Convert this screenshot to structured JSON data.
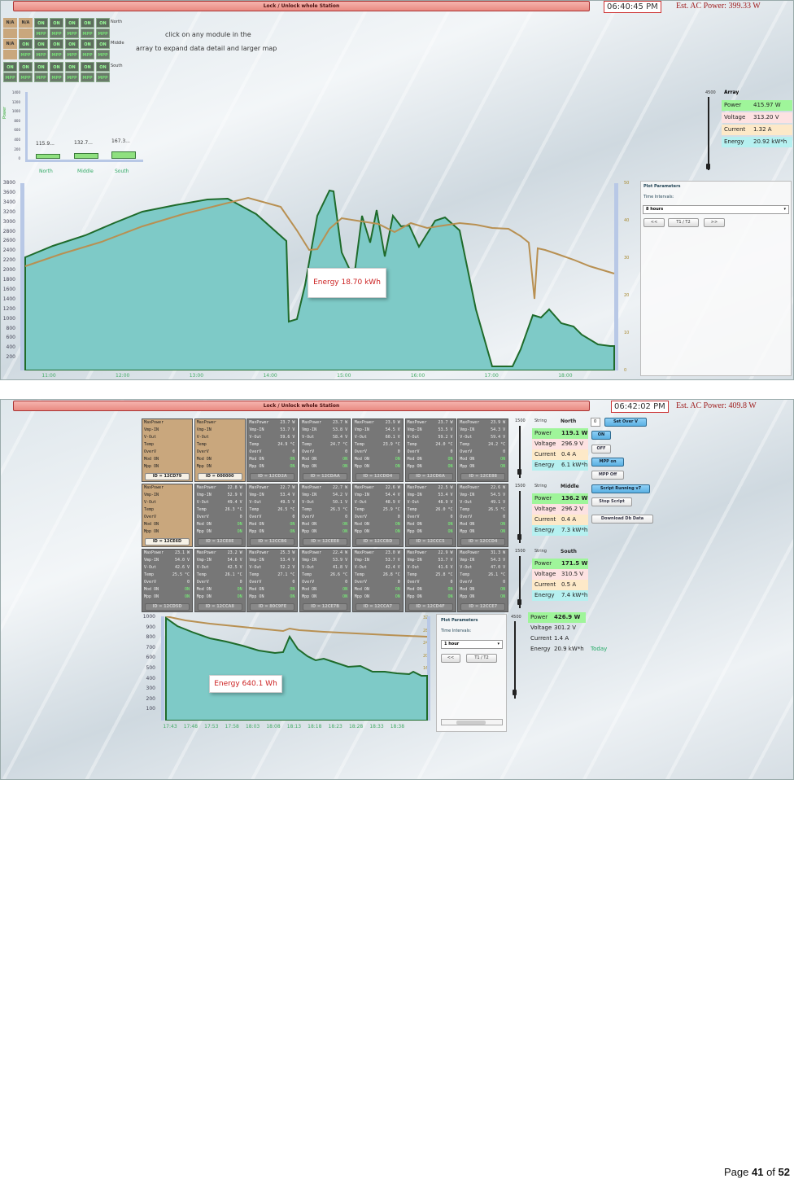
{
  "s1": {
    "lock_label": "Lock / Unlock whole Station",
    "clock": "06:40:45 PM",
    "ac_power": "Est. AC Power: 399.33 W",
    "hint1": "click on any module in the",
    "hint2": "array to expand data detail and larger map",
    "rows": [
      {
        "label": "North",
        "top": [
          "N/A",
          "N/A",
          "ON",
          "ON",
          "ON",
          "ON",
          "ON"
        ],
        "bottom": [
          "",
          "",
          "MPP",
          "MPP",
          "MPP",
          "MPP",
          "MPP"
        ]
      },
      {
        "label": "Middle",
        "top": [
          "N/A",
          "ON",
          "ON",
          "ON",
          "ON",
          "ON",
          "ON"
        ],
        "bottom": [
          "",
          "MPP",
          "MPP",
          "MPP",
          "MPP",
          "MPP",
          "MPP"
        ]
      },
      {
        "label": "South",
        "top": [
          "ON",
          "ON",
          "ON",
          "ON",
          "ON",
          "ON",
          "ON"
        ],
        "bottom": [
          "MPP",
          "MPP",
          "MPP",
          "MPP",
          "MPP",
          "MPP",
          "MPP"
        ]
      }
    ],
    "bar_labels": [
      "115.9...",
      "132.7...",
      "167.3..."
    ],
    "bar_cats": [
      "North",
      "Middle",
      "South"
    ],
    "bar_ylabel": "Power",
    "bar_yticks": [
      "1400",
      "1200",
      "1000",
      "800",
      "600",
      "400",
      "200",
      "0"
    ],
    "slider_max": "4500",
    "array_title": "Array",
    "readouts": [
      {
        "label": "Power",
        "value": "415.97 W"
      },
      {
        "label": "Voltage",
        "value": "313.20 V"
      },
      {
        "label": "Current",
        "value": "1.32 A"
      },
      {
        "label": "Energy",
        "value": "20.92 kW*h"
      }
    ],
    "energy_label": "Energy 18.70 kWh",
    "plot_params": "Plot Parameters",
    "time_intervals": "Time Intervals:",
    "interval": "8 hours",
    "btn_prev": "<<",
    "btn_t1t2": "T1 / T2",
    "btn_next": ">>",
    "yticks_left": [
      "3800",
      "3600",
      "3400",
      "3200",
      "3000",
      "2800",
      "2600",
      "2400",
      "2200",
      "2000",
      "1800",
      "1600",
      "1400",
      "1200",
      "1000",
      "800",
      "600",
      "400",
      "200"
    ],
    "yticks_right": [
      "50",
      "40",
      "30",
      "20",
      "10",
      "0"
    ],
    "xticks": [
      "11:00",
      "12:00",
      "13:00",
      "14:00",
      "15:00",
      "16:00",
      "17:00",
      "18:00"
    ]
  },
  "s2": {
    "lock_label": "Lock / Unlock whole Station",
    "clock": "06:42:02 PM",
    "ac_power": "Est. AC Power: 409.8 W",
    "modules": [
      [
        {
          "t": "tan",
          "max": "",
          "vmp": "",
          "vout": "",
          "temp": "",
          "overv": "",
          "mod": "",
          "mpp": "",
          "id": "ID = 12CD79"
        },
        {
          "t": "tan",
          "max": "",
          "vmp": "",
          "vout": "",
          "temp": "",
          "overv": "",
          "mod": "",
          "mpp": "",
          "id": "ID = 000000"
        },
        {
          "t": "gray",
          "max": "23.7 W",
          "vmp": "53.7 V",
          "vout": "59.6 V",
          "temp": "24.9 °C",
          "overv": "0",
          "mod": "ON",
          "mpp": "ON",
          "id": "ID = 12CD2A"
        },
        {
          "t": "gray",
          "max": "23.7 W",
          "vmp": "53.8 V",
          "vout": "58.4 V",
          "temp": "24.7 °C",
          "overv": "0",
          "mod": "ON",
          "mpp": "ON",
          "id": "ID = 12CDAA"
        },
        {
          "t": "gray",
          "max": "23.9 W",
          "vmp": "54.5 V",
          "vout": "60.1 V",
          "temp": "23.9 °C",
          "overv": "0",
          "mod": "ON",
          "mpp": "ON",
          "id": "ID = 12CDD4"
        },
        {
          "t": "gray",
          "max": "23.7 W",
          "vmp": "53.5 V",
          "vout": "59.2 V",
          "temp": "24.0 °C",
          "overv": "0",
          "mod": "ON",
          "mpp": "ON",
          "id": "ID = 12CD6A"
        },
        {
          "t": "gray",
          "max": "23.9 W",
          "vmp": "54.3 V",
          "vout": "59.4 V",
          "temp": "24.2 °C",
          "overv": "0",
          "mod": "ON",
          "mpp": "ON",
          "id": "ID = 12CE88"
        }
      ],
      [
        {
          "t": "tan",
          "max": "",
          "vmp": "",
          "vout": "",
          "temp": "",
          "overv": "",
          "mod": "",
          "mpp": "",
          "id": "ID = 12CE6D"
        },
        {
          "t": "gray",
          "max": "22.8 W",
          "vmp": "52.9 V",
          "vout": "49.4 V",
          "temp": "26.3 °C",
          "overv": "0",
          "mod": "ON",
          "mpp": "ON",
          "id": "ID = 12CE8E"
        },
        {
          "t": "gray",
          "max": "22.7 W",
          "vmp": "53.4 V",
          "vout": "49.5 V",
          "temp": "26.5 °C",
          "overv": "0",
          "mod": "ON",
          "mpp": "ON",
          "id": "ID = 12CCB6"
        },
        {
          "t": "gray",
          "max": "22.7 W",
          "vmp": "54.2 V",
          "vout": "50.1 V",
          "temp": "26.3 °C",
          "overv": "0",
          "mod": "ON",
          "mpp": "ON",
          "id": "ID = 12CEE8"
        },
        {
          "t": "gray",
          "max": "22.6 W",
          "vmp": "54.4 V",
          "vout": "48.9 V",
          "temp": "25.9 °C",
          "overv": "0",
          "mod": "ON",
          "mpp": "ON",
          "id": "ID = 12CCBD"
        },
        {
          "t": "gray",
          "max": "22.5 W",
          "vmp": "53.4 V",
          "vout": "48.9 V",
          "temp": "26.0 °C",
          "overv": "0",
          "mod": "ON",
          "mpp": "ON",
          "id": "ID = 12CCC5"
        },
        {
          "t": "gray",
          "max": "22.6 W",
          "vmp": "54.5 V",
          "vout": "49.1 V",
          "temp": "26.5 °C",
          "overv": "0",
          "mod": "ON",
          "mpp": "ON",
          "id": "ID = 12CCD4"
        }
      ],
      [
        {
          "t": "gray",
          "max": "23.1 W",
          "vmp": "54.0 V",
          "vout": "42.6 V",
          "temp": "25.5 °C",
          "overv": "0",
          "mod": "ON",
          "mpp": "ON",
          "id": "ID = 12CD5D"
        },
        {
          "t": "gray",
          "max": "23.2 W",
          "vmp": "54.6 V",
          "vout": "42.5 V",
          "temp": "26.1 °C",
          "overv": "0",
          "mod": "ON",
          "mpp": "ON",
          "id": "ID = 12CCA8"
        },
        {
          "t": "gray",
          "max": "25.3 W",
          "vmp": "53.4 V",
          "vout": "52.2 V",
          "temp": "27.1 °C",
          "overv": "0",
          "mod": "ON",
          "mpp": "ON",
          "id": "ID = 80C9FE"
        },
        {
          "t": "gray",
          "max": "22.4 W",
          "vmp": "53.9 V",
          "vout": "41.8 V",
          "temp": "26.6 °C",
          "overv": "0",
          "mod": "ON",
          "mpp": "ON",
          "id": "ID = 12CE7B"
        },
        {
          "t": "gray",
          "max": "23.0 W",
          "vmp": "53.7 V",
          "vout": "42.4 V",
          "temp": "26.8 °C",
          "overv": "0",
          "mod": "ON",
          "mpp": "ON",
          "id": "ID = 12CCA7"
        },
        {
          "t": "gray",
          "max": "22.9 W",
          "vmp": "53.7 V",
          "vout": "41.6 V",
          "temp": "25.8 °C",
          "overv": "0",
          "mod": "ON",
          "mpp": "ON",
          "id": "ID = 12CD4F"
        },
        {
          "t": "gray",
          "max": "31.3 W",
          "vmp": "54.3 V",
          "vout": "47.0 V",
          "temp": "26.1 °C",
          "overv": "0",
          "mod": "ON",
          "mpp": "ON",
          "id": "ID = 12CCE7"
        }
      ]
    ],
    "mod_labels": {
      "max": "MaxPower",
      "vmp": "Vmp-IN",
      "vout": "V-Out",
      "temp": "Temp",
      "overv": "OverV",
      "mod": "Mod ON",
      "mpp": "Mpp ON"
    },
    "strings": [
      {
        "max": "1500",
        "label": "String",
        "name": "North",
        "power": "119.1 W",
        "voltage": "296.9 V",
        "current": "0.4 A",
        "energy": "6.1 kW*h"
      },
      {
        "max": "1500",
        "label": "String",
        "name": "Middle",
        "power": "136.2 W",
        "voltage": "296.2 V",
        "current": "0.4 A",
        "energy": "7.3 kW*h"
      },
      {
        "max": "1500",
        "label": "String",
        "name": "South",
        "power": "171.5 W",
        "voltage": "310.5 V",
        "current": "0.5 A",
        "energy": "7.4 kW*h"
      }
    ],
    "rd_labels": {
      "power": "Power",
      "voltage": "Voltage",
      "current": "Current",
      "energy": "Energy"
    },
    "total": {
      "max": "4500",
      "power": "426.9 W",
      "voltage": "301.2 V",
      "current": "1.4 A",
      "energy": "20.9 kW*h",
      "today": "Today"
    },
    "setover_value": "0",
    "buttons": {
      "setover": "Set Over V",
      "on": "ON",
      "off": "OFF",
      "mppon": "MPP on",
      "mppoff": "MPP Off",
      "script": "Script Running v7",
      "stop": "Stop Script",
      "download": "Download Db Data"
    },
    "energy_label": "Energy 640.1 Wh",
    "plot_params": "Plot Parameters",
    "time_intervals": "Time Intervals:",
    "interval": "1 hour",
    "btn_prev": "<<",
    "btn_t1t2": "T1 / T2",
    "yticks_left": [
      "1000",
      "900",
      "800",
      "700",
      "600",
      "500",
      "400",
      "300",
      "200",
      "100"
    ],
    "yticks_right": [
      "32",
      "28",
      "24",
      "20",
      "16",
      "12",
      "8",
      "4",
      "0"
    ],
    "xticks": [
      "17:43",
      "17:48",
      "17:53",
      "17:58",
      "18:03",
      "18:08",
      "18:13",
      "18:18",
      "18:23",
      "18:28",
      "18:33",
      "18:38"
    ]
  },
  "footer": {
    "prefix": "Page ",
    "num": "41",
    "mid": " of ",
    "total": "52"
  }
}
